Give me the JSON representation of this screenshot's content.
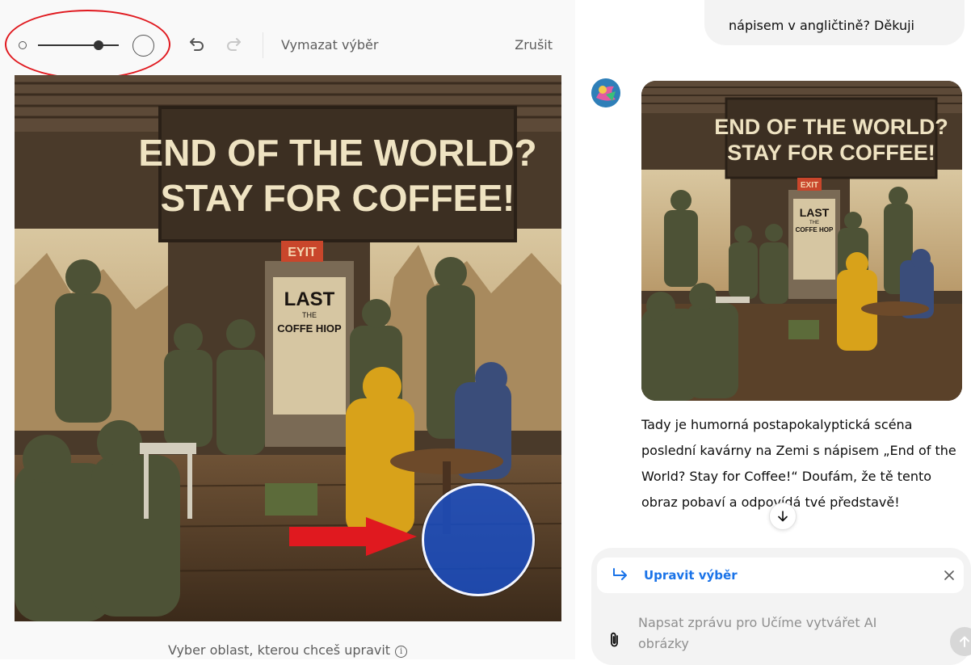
{
  "editor": {
    "clear_label": "Vymazat výběr",
    "cancel_label": "Zrušit",
    "hint": "Vyber oblast, kterou chceš upravit",
    "icons": {
      "undo": "undo-icon",
      "redo": "redo-icon",
      "info": "info-icon",
      "brush_small": "brush-size-small-icon",
      "brush_large": "brush-size-large-icon"
    },
    "brush_size": 0.75,
    "image": {
      "sign_line1": "END OF THE WORLD?",
      "sign_line2": "STAY FOR COFFEE!",
      "exit_sign": "EYIT",
      "door_line1": "LAST",
      "door_line2": "THE",
      "door_line3": "COFFE HIOP"
    },
    "colors": {
      "annotation_red": "#e0191f",
      "selection_blue": "#1450d2"
    }
  },
  "chat": {
    "user_message_tail": "nápisem v angličtině? Děkuji",
    "assistant_reply": "Tady je humorná postapokalyptická scéna poslední kavárny na Zemi s nápisem „End of the World? Stay for Coffee!“ Doufám, že tě tento obraz pobaví a odpovídá tvé představě!",
    "image": {
      "sign_line1": "END OF THE WORLD?",
      "sign_line2": "STAY FOR COFFEE!",
      "exit_sign": "EXIT",
      "door_line1": "LAST",
      "door_line2": "THE",
      "door_line3": "COFFE HOP"
    },
    "composer": {
      "edit_chip_label": "Upravit výběr",
      "placeholder_line1": "Napsat zprávu pro Učíme vytvářet AI",
      "placeholder_line2": "obrázky"
    },
    "colors": {
      "link_blue": "#1a73e8"
    }
  }
}
